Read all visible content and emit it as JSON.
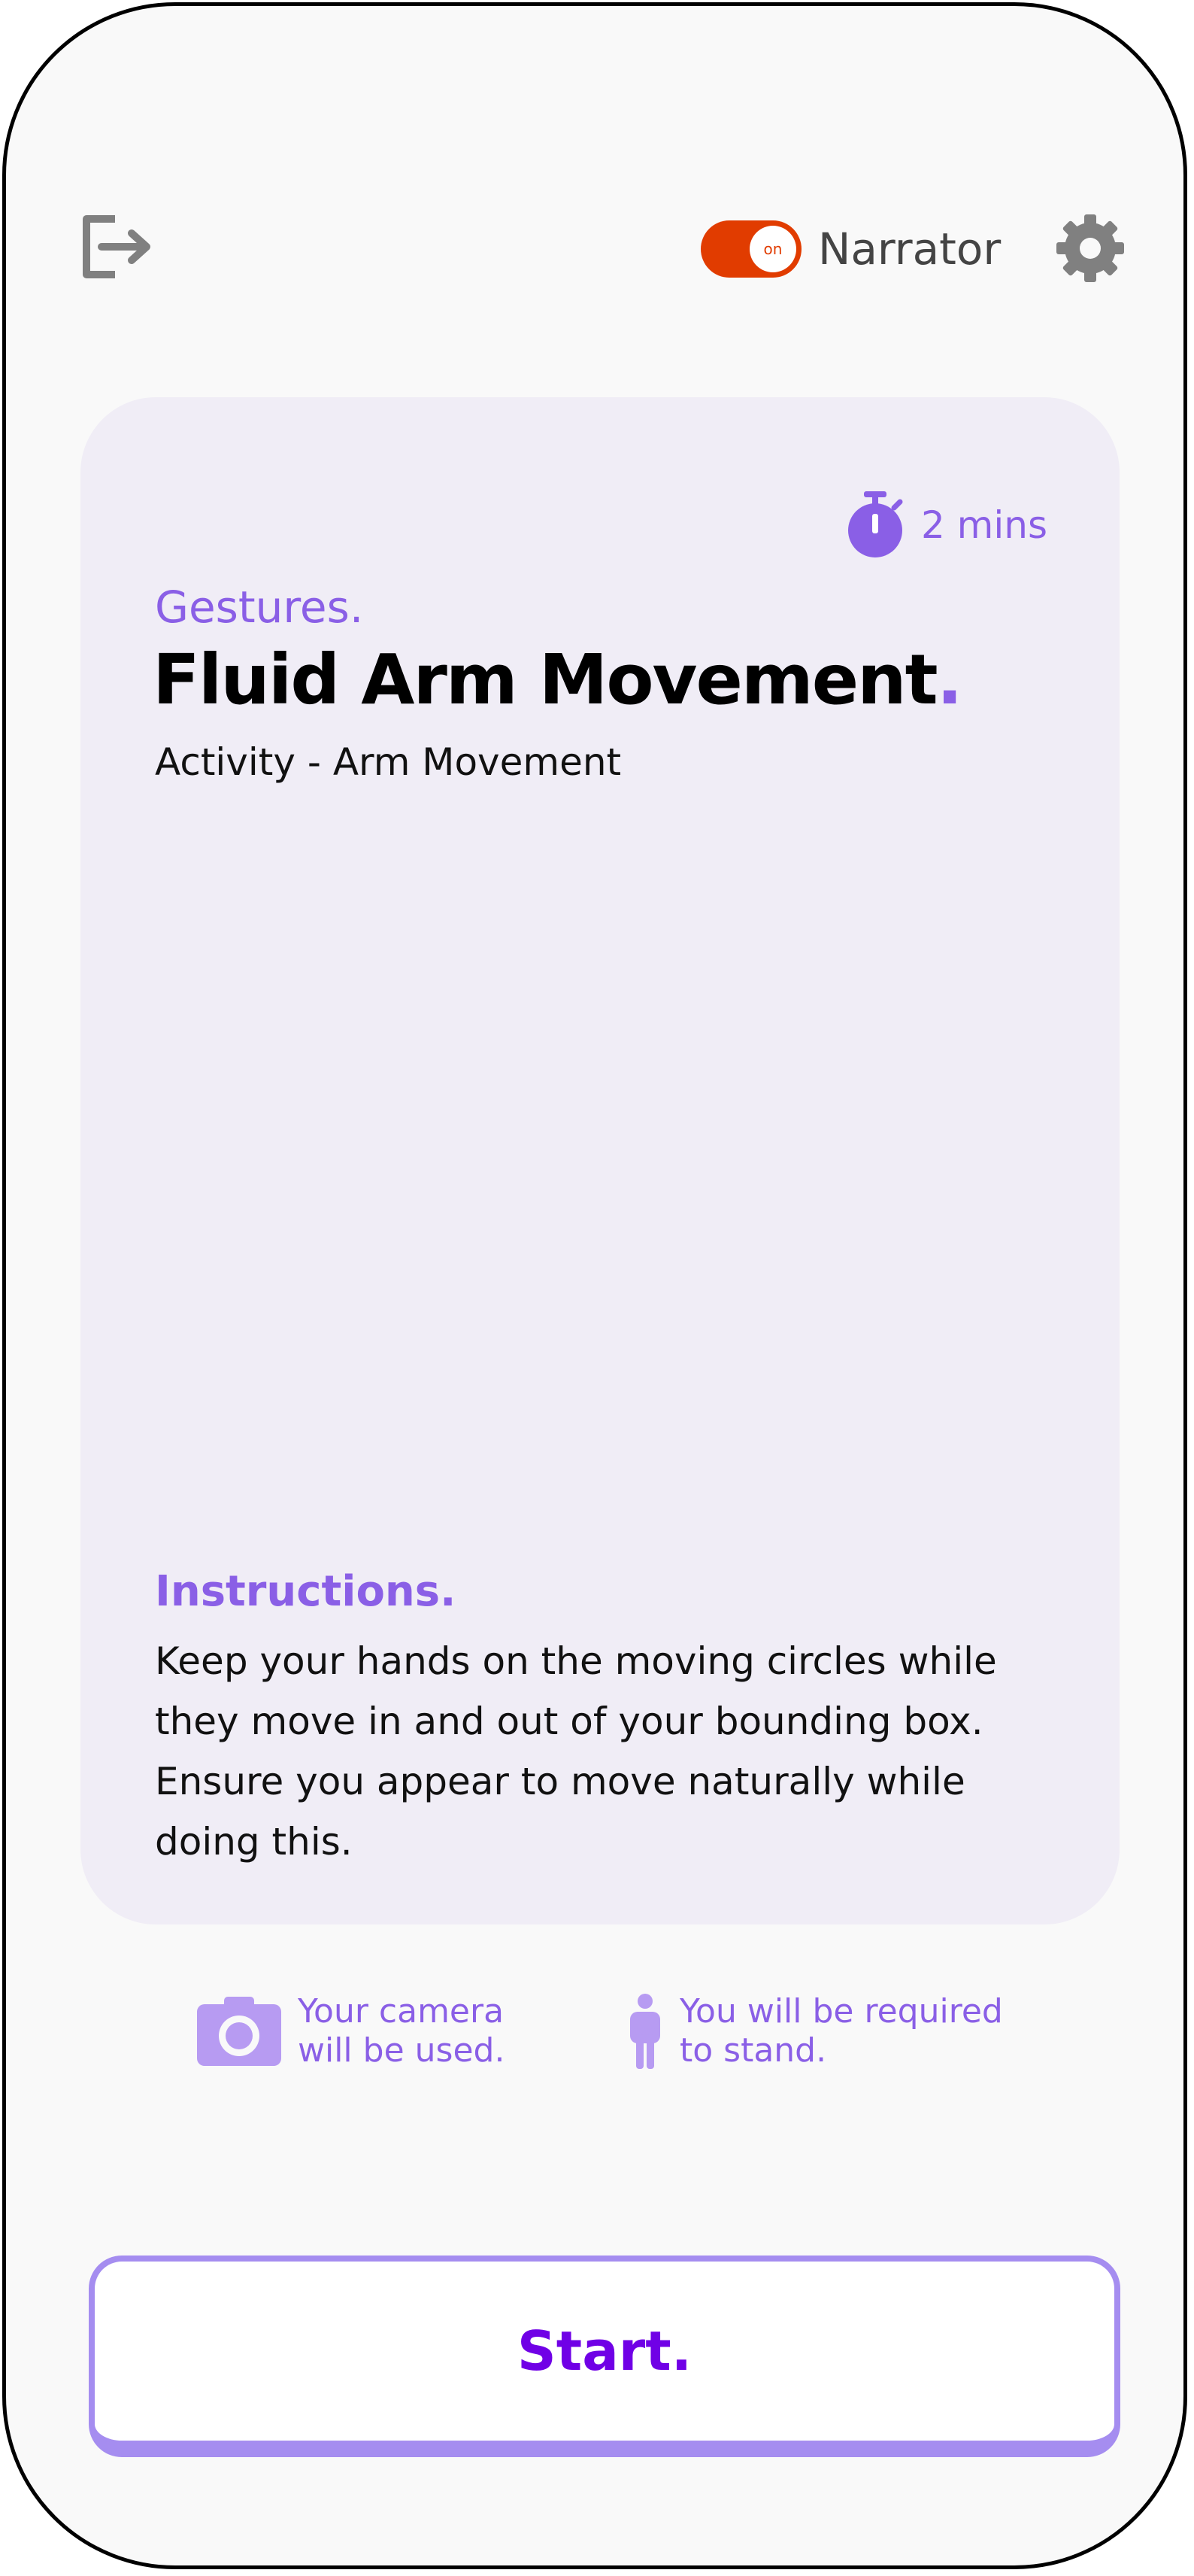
{
  "header": {
    "exit_icon": "exit-icon",
    "narrator": {
      "toggle_state": "on",
      "label": "Narrator"
    },
    "settings_icon": "gear-icon"
  },
  "activity": {
    "duration_icon": "stopwatch-icon",
    "duration": "2 mins",
    "category": "Gestures.",
    "title": "Fluid Arm Movement",
    "title_dot": ".",
    "subtitle": "Activity - Arm Movement",
    "instructions_heading": "Instructions.",
    "instructions_text": "Keep your hands on the moving circles while they move in and out of your bounding box. Ensure you appear to move naturally while doing this."
  },
  "requirements": [
    {
      "icon": "camera-icon",
      "text": "Your camera\nwill be used."
    },
    {
      "icon": "person-standing-icon",
      "text": "You will be required\nto stand."
    }
  ],
  "start_button": {
    "label": "Start."
  },
  "colors": {
    "accent_purple": "#8a5fe6",
    "start_purple": "#7000e6",
    "toggle_orange": "#e13c00",
    "card_bg": "#f0edf6"
  }
}
